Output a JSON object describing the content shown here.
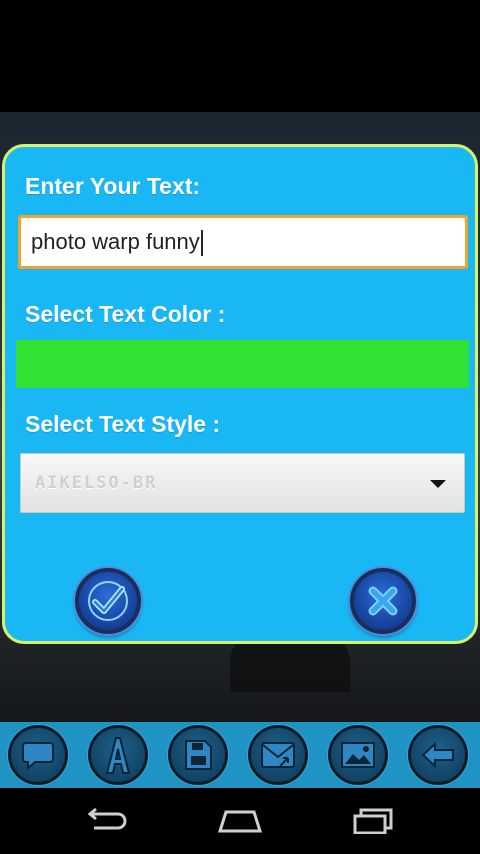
{
  "dialog": {
    "text_label": "Enter Your Text:",
    "text_value": "photo warp funny",
    "color_label": "Select Text Color :",
    "selected_color": "#2fe233",
    "style_label": "Select Text Style :",
    "style_value": "AIKELSO-BR"
  },
  "buttons": {
    "ok_icon": "checkmark-icon",
    "close_icon": "close-icon"
  },
  "toolbar": {
    "items": [
      "speech-bubble-icon",
      "text-style-icon",
      "save-icon",
      "share-icon",
      "gallery-icon",
      "back-icon"
    ]
  },
  "nav": {
    "items": [
      "back-nav-icon",
      "home-nav-icon",
      "recent-apps-icon"
    ]
  },
  "colors": {
    "dialog_bg": "#19b8f5",
    "dialog_border": "#d8f06a",
    "input_border": "#f2a32c",
    "toolbar_bg": "#1e93c4"
  }
}
